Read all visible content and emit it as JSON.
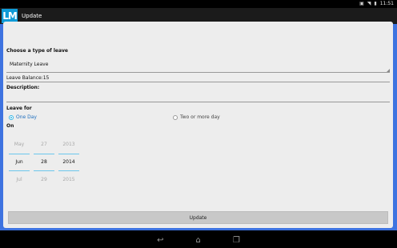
{
  "status_bar": {
    "time": "11:51",
    "icons": [
      "screenshot-icon",
      "wifi-icon",
      "battery-icon"
    ]
  },
  "action_bar": {
    "logo_text": "LM",
    "title": "Update"
  },
  "form": {
    "leave_type_label": "Choose a type of leave",
    "leave_type_value": "Maternity Leave",
    "leave_balance": "Leave Balance:15",
    "description_label": "Description:",
    "description_value": "",
    "leave_for_label": "Leave for",
    "radio_one_day": "One Day",
    "radio_two_more": "Two or more day",
    "selected_radio": "One Day",
    "on_label": "On",
    "date_picker": {
      "month": {
        "prev": "May",
        "current": "Jun",
        "next": "Jul"
      },
      "day": {
        "prev": "27",
        "current": "28",
        "next": "29"
      },
      "year": {
        "prev": "2013",
        "current": "2014",
        "next": "2015"
      }
    },
    "update_button": "Update"
  },
  "colors": {
    "accent_blue": "#3e73e0",
    "holo_blue": "#33b5e5",
    "action_bar": "#1b1b1b"
  },
  "nav_bar": {
    "icons": [
      "back-icon",
      "home-icon",
      "recent-apps-icon"
    ]
  }
}
